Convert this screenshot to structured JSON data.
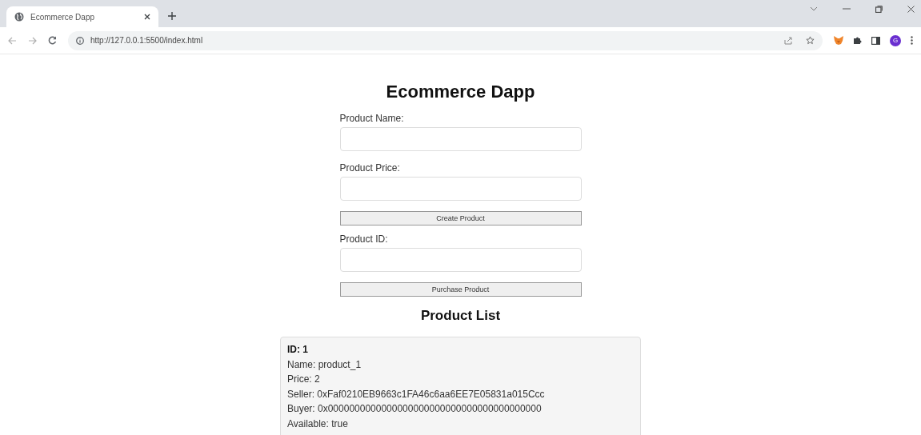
{
  "browser": {
    "tab_title": "Ecommerce Dapp",
    "address": "http://127.0.0.1:5500/index.html",
    "profile_initial": "G"
  },
  "page": {
    "title": "Ecommerce Dapp",
    "create_form": {
      "fields": [
        {
          "label": "Product Name:"
        },
        {
          "label": "Product Price:"
        }
      ],
      "button": "Create Product"
    },
    "purchase_form": {
      "fields": [
        {
          "label": "Product ID:"
        }
      ],
      "button": "Purchase Product"
    },
    "list_title": "Product List",
    "products": [
      {
        "id": "ID: 1",
        "lines": [
          "Name: product_1",
          "Price: 2",
          "Seller: 0xFaf0210EB9663c1FA46c6aa6EE7E05831a015Ccc",
          "Buyer: 0x0000000000000000000000000000000000000000",
          "Available: true"
        ]
      }
    ]
  }
}
